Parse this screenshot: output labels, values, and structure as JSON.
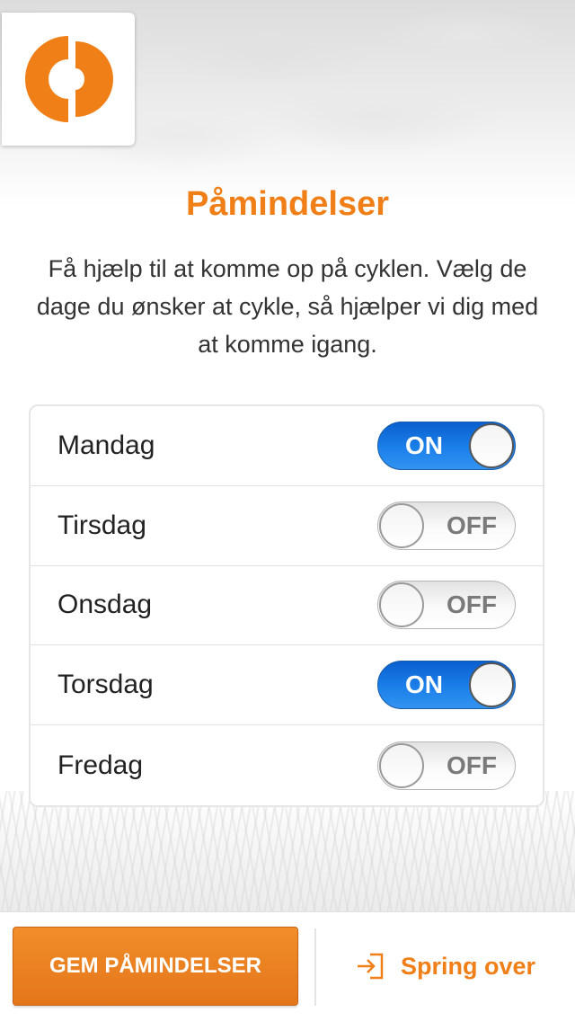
{
  "header": {
    "title": "Påmindelser",
    "intro": "Få hjælp til at komme op på cyklen. Vælg de dage du ønsker at cykle, så hjælper vi dig med at komme igang."
  },
  "days": [
    {
      "label": "Mandag",
      "state": "ON"
    },
    {
      "label": "Tirsdag",
      "state": "OFF"
    },
    {
      "label": "Onsdag",
      "state": "OFF"
    },
    {
      "label": "Torsdag",
      "state": "ON"
    },
    {
      "label": "Fredag",
      "state": "OFF"
    }
  ],
  "footer": {
    "save_label": "GEM PÅMINDELSER",
    "skip_label": "Spring over",
    "skip_icon": "sign-in-arrow-icon"
  },
  "logo": {
    "icon": "app-logo-icon"
  },
  "colors": {
    "accent": "#f07f18",
    "toggle_on": "#1b80ea"
  }
}
